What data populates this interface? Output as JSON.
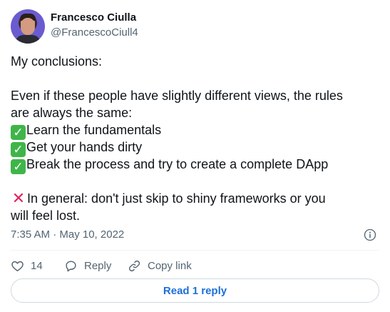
{
  "author": {
    "name": "Francesco Ciulla",
    "handle": "@FrancescoCiull4"
  },
  "tweet": {
    "line1": "My conclusions:",
    "line2": "Even if these people have slightly different views, the rules",
    "line3": "are always the same:",
    "item1": "Learn the fundamentals",
    "item2": "Get your hands dirty",
    "item3": "Break the process and try to create a complete DApp",
    "warn1": "In general: don't just skip to shiny frameworks or you",
    "warn2": "will feel lost."
  },
  "meta": {
    "timestamp": "7:35 AM · May 10, 2022"
  },
  "actions": {
    "like_count": "14",
    "reply_label": "Reply",
    "copy_label": "Copy link"
  },
  "read_reply_label": "Read 1 reply",
  "icons": {
    "avatar": "avatar",
    "info": "info-icon",
    "like": "heart-icon",
    "reply": "reply-icon",
    "copy": "link-icon",
    "check": "check-mark-icon",
    "cross": "cross-mark-icon"
  },
  "colors": {
    "link": "#1d6fd8",
    "secondary_text": "#536471",
    "check": "#3fb549",
    "cross": "#e0245e"
  }
}
